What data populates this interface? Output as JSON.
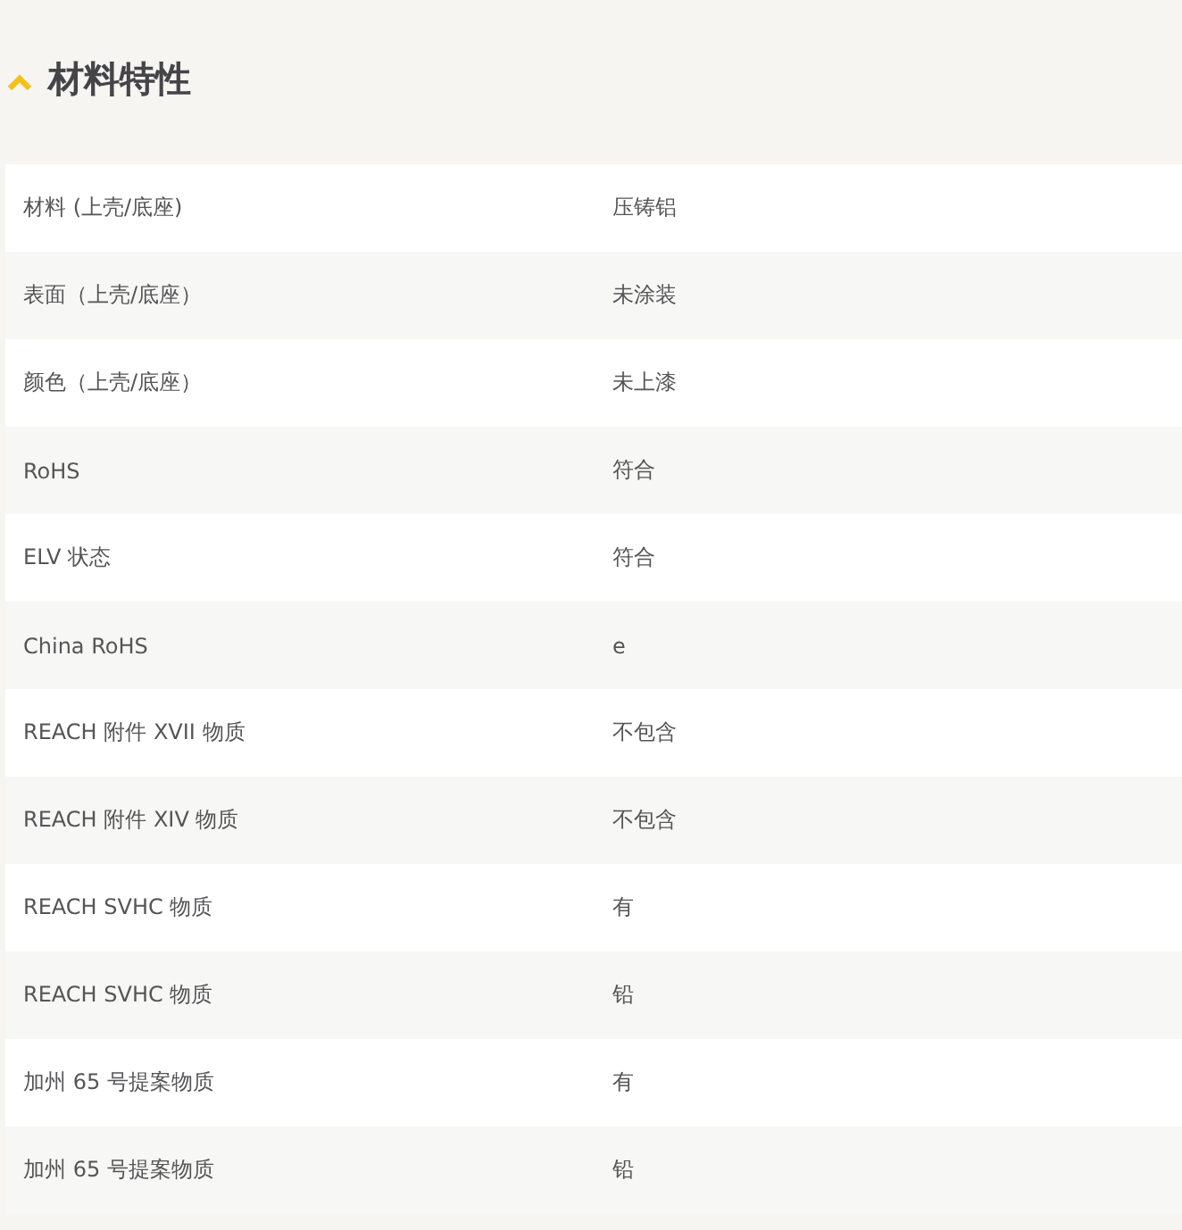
{
  "section": {
    "title": "材料特性",
    "expanded": true
  },
  "rows": [
    {
      "label": "材料 (上壳/底座)",
      "value": "压铸铝"
    },
    {
      "label": "表面（上壳/底座）",
      "value": "未涂装"
    },
    {
      "label": "颜色（上壳/底座）",
      "value": "未上漆"
    },
    {
      "label": "RoHS",
      "value": "符合"
    },
    {
      "label": "ELV 状态",
      "value": "符合"
    },
    {
      "label": "China RoHS",
      "value": "e"
    },
    {
      "label": "REACH 附件 XVII 物质",
      "value": "不包含"
    },
    {
      "label": "REACH 附件 XIV 物质",
      "value": "不包含"
    },
    {
      "label": "REACH SVHC 物质",
      "value": "有"
    },
    {
      "label": "REACH SVHC 物质",
      "value": "铅"
    },
    {
      "label": "加州 65 号提案物质",
      "value": "有"
    },
    {
      "label": "加州 65 号提案物质",
      "value": "铅"
    }
  ]
}
